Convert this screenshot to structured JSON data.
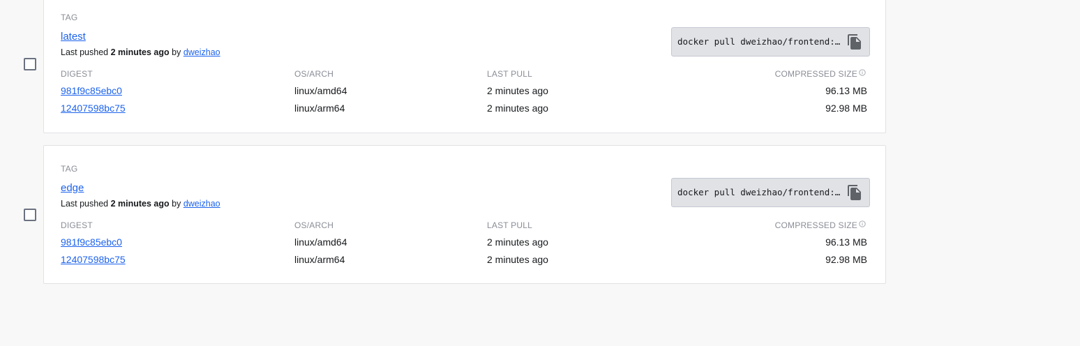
{
  "columns": {
    "tag": "TAG",
    "digest": "DIGEST",
    "os_arch": "OS/ARCH",
    "last_pull": "LAST PULL",
    "compressed_size": "COMPRESSED SIZE"
  },
  "tags": [
    {
      "name": "latest",
      "pushed_prefix": "Last pushed",
      "pushed_time": "2 minutes ago",
      "pushed_by_word": "by",
      "pushed_by": "dweizhao",
      "pull_command": "docker pull dweizhao/frontend:latest",
      "rows": [
        {
          "digest": "981f9c85ebc0",
          "os_arch": "linux/amd64",
          "last_pull": "2 minutes ago",
          "size": "96.13 MB"
        },
        {
          "digest": "12407598bc75",
          "os_arch": "linux/arm64",
          "last_pull": "2 minutes ago",
          "size": "92.98 MB"
        }
      ]
    },
    {
      "name": "edge",
      "pushed_prefix": "Last pushed",
      "pushed_time": "2 minutes ago",
      "pushed_by_word": "by",
      "pushed_by": "dweizhao",
      "pull_command": "docker pull dweizhao/frontend:edge",
      "rows": [
        {
          "digest": "981f9c85ebc0",
          "os_arch": "linux/amd64",
          "last_pull": "2 minutes ago",
          "size": "96.13 MB"
        },
        {
          "digest": "12407598bc75",
          "os_arch": "linux/arm64",
          "last_pull": "2 minutes ago",
          "size": "92.98 MB"
        }
      ]
    }
  ],
  "icons": {
    "copy": "copy-icon",
    "info": "info-icon",
    "checkbox": "checkbox"
  },
  "colors": {
    "link": "#1d63ed",
    "muted": "#8a8d96",
    "command_bg": "#e1e2e6"
  }
}
